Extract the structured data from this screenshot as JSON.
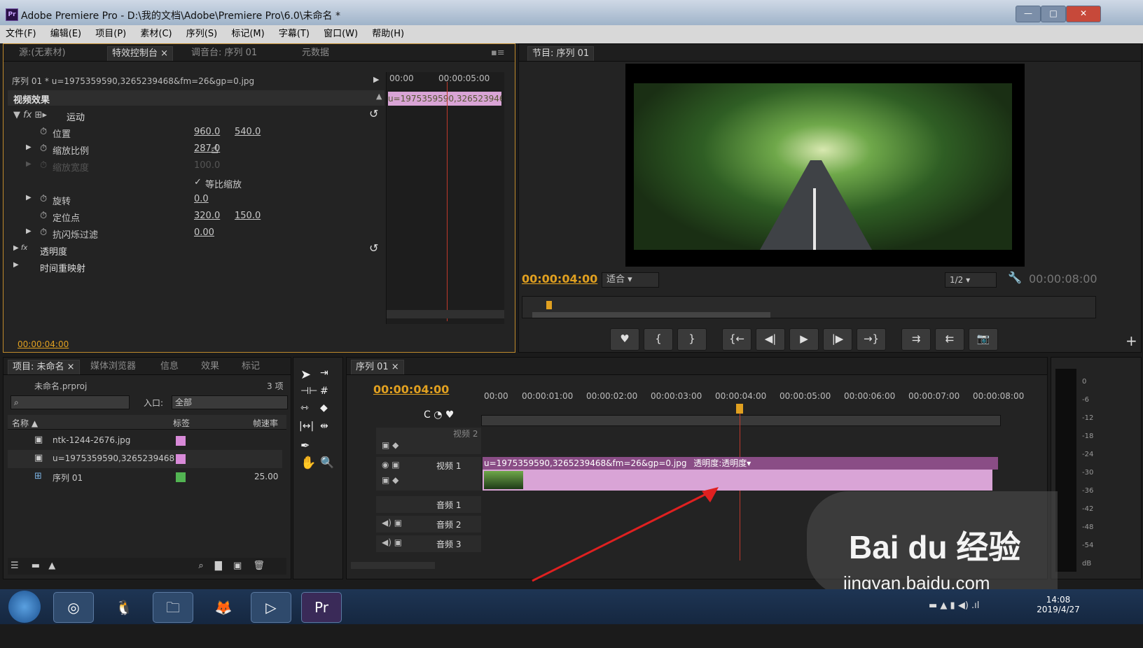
{
  "window": {
    "title": "Adobe Premiere Pro - D:\\我的文档\\Adobe\\Premiere Pro\\6.0\\未命名 *",
    "logo": "Pr"
  },
  "menu": [
    "文件(F)",
    "编辑(E)",
    "项目(P)",
    "素材(C)",
    "序列(S)",
    "标记(M)",
    "字幕(T)",
    "窗口(W)",
    "帮助(H)"
  ],
  "effects_panel": {
    "tabs": [
      "源:(无素材)",
      "特效控制台 ×",
      "调音台: 序列 01",
      "元数据"
    ],
    "clip_header": "序列 01 * u=1975359590,3265239468&fm=26&gp=0.jpg",
    "mini_time": [
      "00:00",
      "00:00:05:00"
    ],
    "mini_clip": "u=1975359590,3265239468",
    "section": "视频效果",
    "motion": "运动",
    "position_label": "位置",
    "position_x": "960.0",
    "position_y": "540.0",
    "scale_label": "缩放比例",
    "scale_value": "287.0",
    "scale_width_label": "缩放宽度",
    "scale_width_value": "100.0",
    "uniform_label": "等比缩放",
    "rotation_label": "旋转",
    "rotation_value": "0.0",
    "anchor_label": "定位点",
    "anchor_x": "320.0",
    "anchor_y": "150.0",
    "antiflicker_label": "抗闪烁过滤",
    "antiflicker_value": "0.00",
    "opacity_label": "透明度",
    "timeremap_label": "时间重映射",
    "timecode": "00:00:04:00"
  },
  "program_panel": {
    "tab": "节目: 序列 01",
    "timecode": "00:00:04:00",
    "fit": "适合",
    "quality": "1/2",
    "duration": "00:00:08:00",
    "controls": [
      "♥",
      "{",
      "}",
      "{←",
      "◀|",
      "▶",
      "|▶",
      "→}",
      "⇉",
      "⇇",
      "📷"
    ]
  },
  "project_panel": {
    "tabs": [
      "项目: 未命名 ×",
      "媒体浏览器",
      "信息",
      "效果",
      "标记"
    ],
    "file": "未命名.prproj",
    "count": "3 项",
    "in_label": "入口:",
    "in_value": "全部",
    "columns": [
      "名称 ▲",
      "标签",
      "帧速率"
    ],
    "items": [
      {
        "name": "ntk-1244-2676.jpg",
        "color": "#d88ad8",
        "rate": ""
      },
      {
        "name": "u=1975359590,3265239468",
        "color": "#d88ad8",
        "rate": ""
      },
      {
        "name": "序列 01",
        "color": "#52b452",
        "rate": "25.00"
      }
    ]
  },
  "timeline": {
    "tab": "序列 01 ×",
    "timecode": "00:00:04:00",
    "ruler": [
      "00:00",
      "00:00:01:00",
      "00:00:02:00",
      "00:00:03:00",
      "00:00:04:00",
      "00:00:05:00",
      "00:00:06:00",
      "00:00:07:00",
      "00:00:08:00"
    ],
    "tracks": [
      "视频 2",
      "视频 1",
      "音频 1",
      "音频 2",
      "音频 3"
    ],
    "clip_title": "u=1975359590,3265239468&fm=26&gp=0.jpg",
    "clip_fx": "透明度:透明度▾"
  },
  "meter_ticks": [
    "0",
    "-6",
    "-12",
    "-18",
    "-24",
    "-30",
    "-36",
    "-42",
    "-48",
    "-54",
    "dB"
  ],
  "taskbar": {
    "time": "14:08",
    "date": "2019/4/27"
  },
  "watermark": {
    "logo": "Bai du 经验",
    "url": "jingyan.baidu.com"
  },
  "colors": {
    "accent": "#e0a020",
    "clip": "#d9a4d6",
    "playhead": "#c0392b"
  }
}
